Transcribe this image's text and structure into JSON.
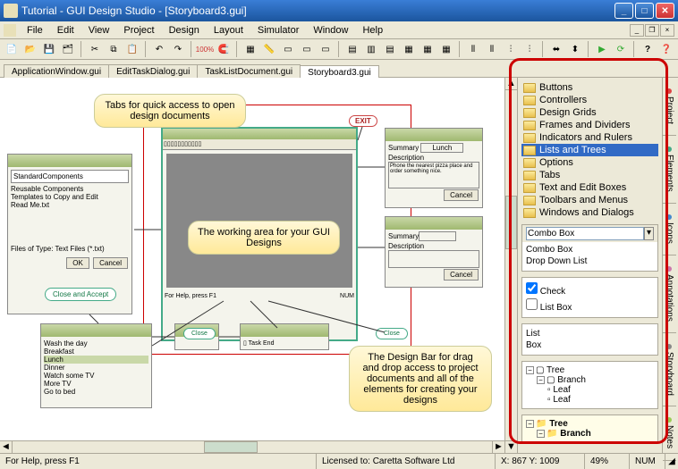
{
  "window": {
    "title": "Tutorial - GUI Design Studio - [Storyboard3.gui]"
  },
  "menu": {
    "items": [
      "File",
      "Edit",
      "View",
      "Project",
      "Design",
      "Layout",
      "Simulator",
      "Window",
      "Help"
    ]
  },
  "tabs": {
    "items": [
      "ApplicationWindow.gui",
      "EditTaskDialog.gui",
      "TaskListDocument.gui",
      "Storyboard3.gui"
    ],
    "active": 3
  },
  "callouts": {
    "tabs": "Tabs for quick access to open design documents",
    "working": "The working area for your GUI Designs",
    "designbar": "The Design Bar for drag and drop access to project documents and all of the elements for creating your designs"
  },
  "canvas": {
    "exit": "EXIT",
    "close_accept": "Close and Accept",
    "close": "Close",
    "reusable": "Reusable Components",
    "templates": "Templates to Copy and Edit",
    "readme": "Read Me.txt",
    "summary": "Summary",
    "lunch": "Lunch",
    "description": "Description",
    "desc_text": "Phone the nearest pizza place and order something nice.",
    "cancel": "Cancel",
    "ok": "OK",
    "forhelp": "For Help, press F1",
    "standardcomponents": "StandardComponents",
    "washcar": "Wash the day",
    "breakfast": "Breakfast",
    "dinner": "Dinner",
    "watchtv": "Watch some TV",
    "moretv": "More TV",
    "gotobed": "Go to bed",
    "filesoftype": "Files of Type",
    "textfiles": "Text Files (*.txt)"
  },
  "designbar": {
    "folders": [
      "Buttons",
      "Controllers",
      "Design Grids",
      "Frames and Dividers",
      "Indicators and Rulers",
      "Lists and Trees",
      "Options",
      "Tabs",
      "Text and Edit Boxes",
      "Toolbars and Menus",
      "Windows and Dialogs"
    ],
    "selected": 5,
    "combo_label": "Combo Box",
    "combo_items": [
      "Combo Box",
      "Drop Down List"
    ],
    "check": "Check",
    "listbox": "List Box",
    "list": "List",
    "box": "Box",
    "tree": "Tree",
    "branch": "Branch",
    "leaf": "Leaf",
    "vtabs": [
      {
        "label": "Project",
        "color": "#d44"
      },
      {
        "label": "Elements",
        "color": "#4a8"
      },
      {
        "label": "Icons",
        "color": "#48c"
      },
      {
        "label": "Annotations",
        "color": "#c7a"
      },
      {
        "label": "Storyboard",
        "color": "#888"
      },
      {
        "label": "Notes",
        "color": "#9c5"
      }
    ]
  },
  "status": {
    "help": "For Help, press F1",
    "license": "Licensed to: Caretta Software Ltd",
    "coords": "X: 867 Y: 1009",
    "zoom": "49%",
    "num": "NUM"
  }
}
